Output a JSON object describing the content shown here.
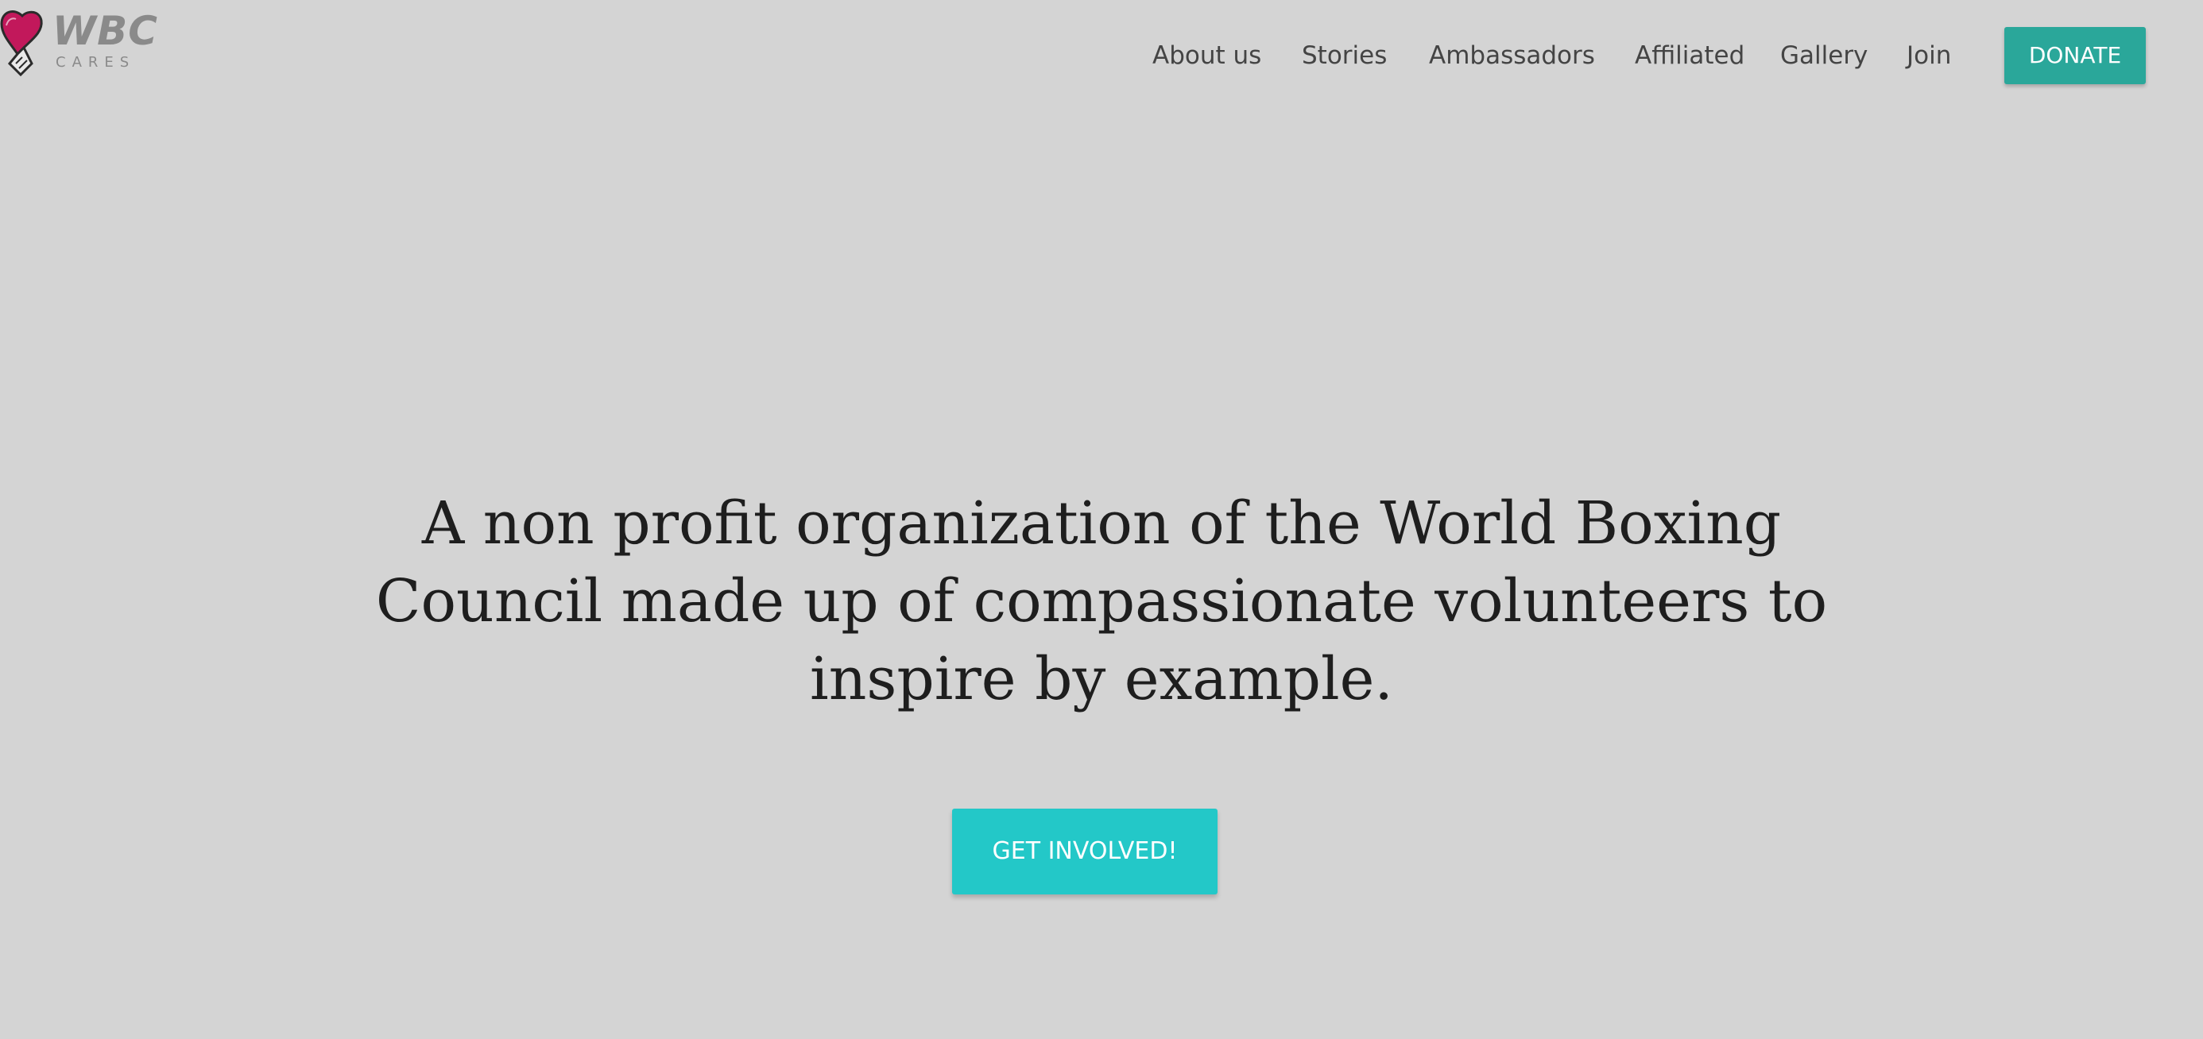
{
  "brand": {
    "wordmark": "WBC",
    "tagline": "CARES",
    "logo_icon": "boxing-glove-heart-icon",
    "colors": {
      "glove": "#c2185b",
      "wordmark": "#8a8a8a"
    }
  },
  "nav": {
    "items": [
      {
        "label": "About us"
      },
      {
        "label": "Stories"
      },
      {
        "label": "Ambassadors"
      },
      {
        "label": "Affiliated"
      },
      {
        "label": "Gallery"
      },
      {
        "label": "Join"
      }
    ],
    "donate_label": "DONATE"
  },
  "hero": {
    "headline": "A non profit organization of the World Boxing Council made up of compassionate volunteers to inspire by example.",
    "cta_label": "GET INVOLVED!"
  },
  "colors": {
    "background": "#d4d4d4",
    "donate": "#2aa79a",
    "cta": "#23c8c8",
    "text": "#1e1e1e"
  }
}
